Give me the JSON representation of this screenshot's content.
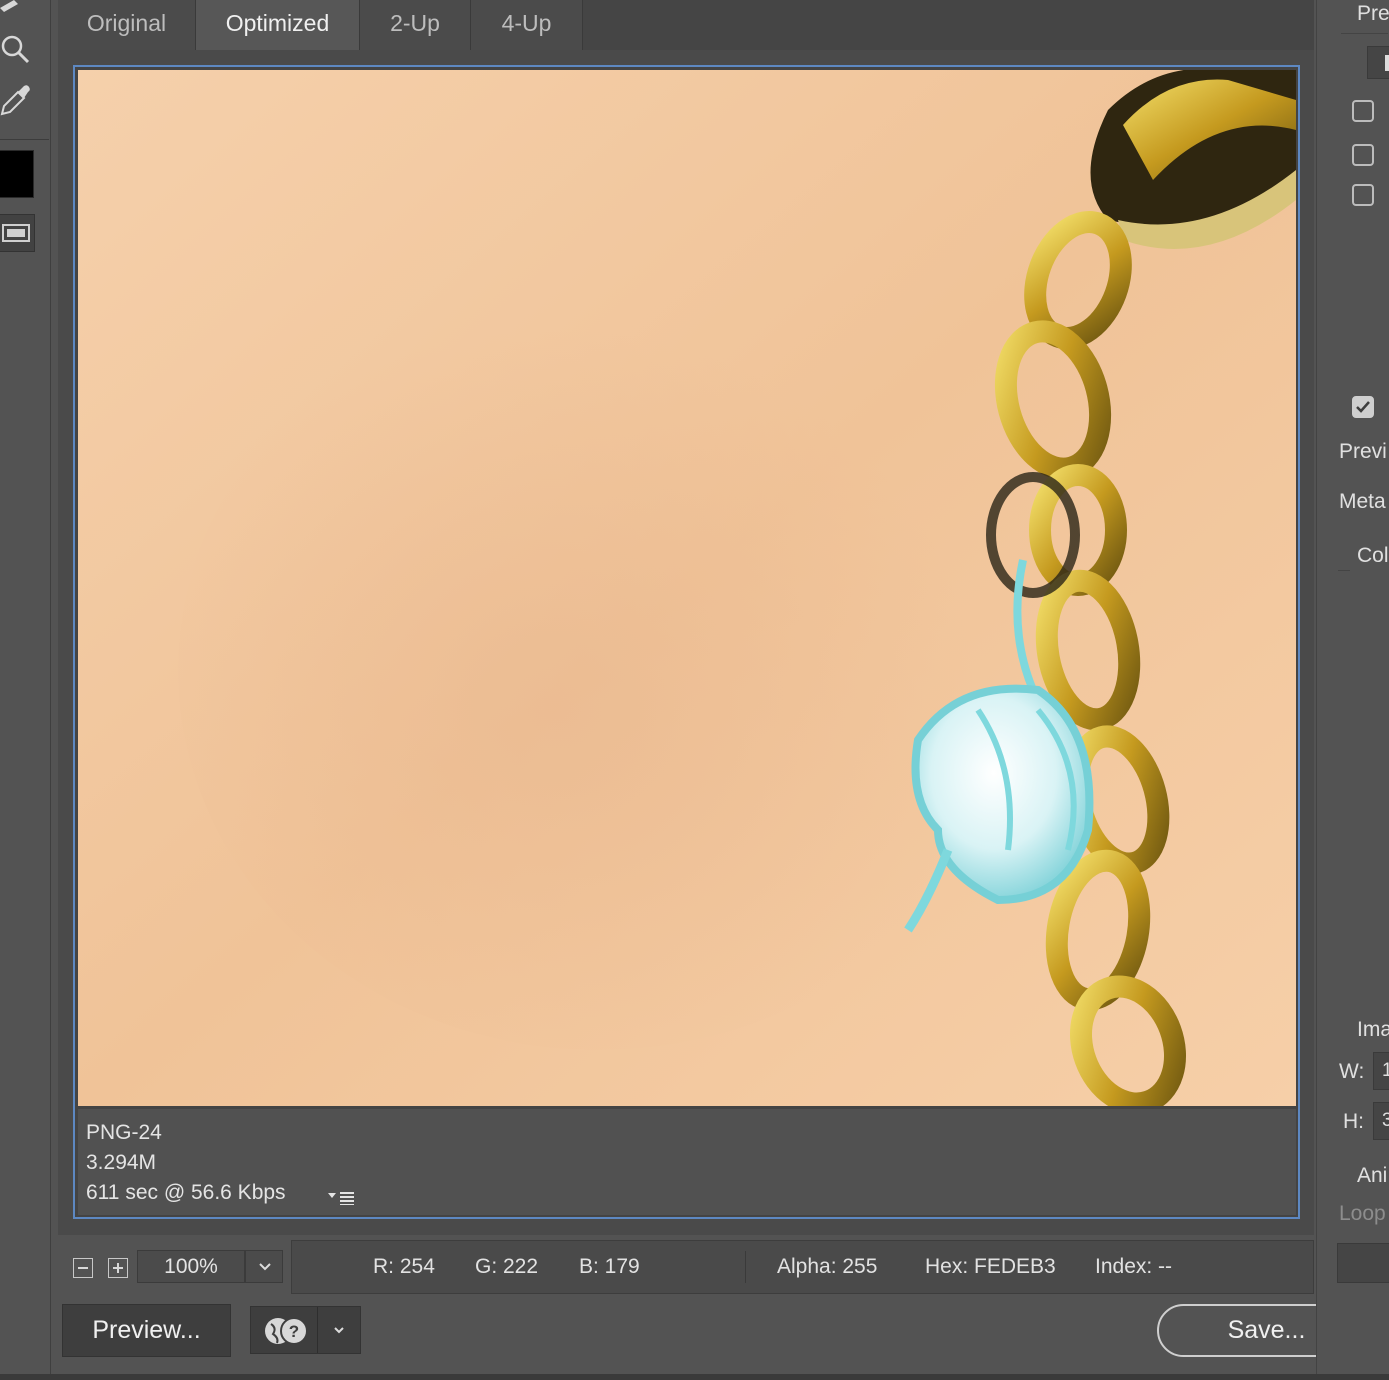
{
  "tabs": [
    {
      "label": "Original",
      "active": false
    },
    {
      "label": "Optimized",
      "active": true
    },
    {
      "label": "2-Up",
      "active": false
    },
    {
      "label": "4-Up",
      "active": false
    }
  ],
  "tools": [
    "zoom-icon",
    "eyedropper-icon",
    "foreground-color-swatch",
    "screen-mode-icon"
  ],
  "image_info": {
    "format": "PNG-24",
    "size": "3.294M",
    "download": "611 sec @ 56.6 Kbps"
  },
  "zoom": {
    "value": "100%"
  },
  "readout": {
    "r": "R: 254",
    "g": "G: 222",
    "b": "B: 179",
    "alpha": "Alpha: 255",
    "hex": "Hex: FEDEB3",
    "index": "Index: --"
  },
  "buttons": {
    "preview": "Preview...",
    "save": "Save..."
  },
  "right_panel": {
    "preset_label": "Pre",
    "preview_label": "Previ",
    "metadata_label": "Meta",
    "color_label": "Col",
    "image_size_label": "Ima",
    "w_label": "W:",
    "w_value": "1",
    "h_label": "H:",
    "h_value": "3",
    "animation_label": "Ani",
    "loop_label": "Loop"
  },
  "colors": {
    "accent_frame": "#5d88c2",
    "skin": "#f3c8a0",
    "gold": "#c9a22a",
    "turquoise": "#7ed8dd"
  }
}
